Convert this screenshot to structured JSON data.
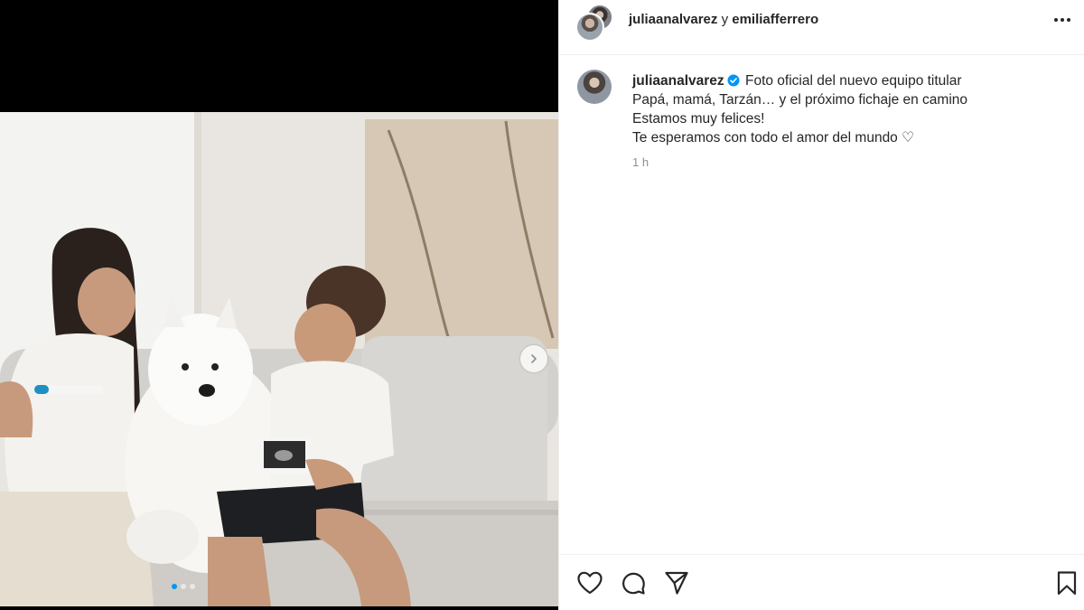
{
  "post": {
    "carousel": {
      "total_slides": 3,
      "current_slide": 1,
      "next_icon": "chevron-right-icon"
    }
  },
  "header": {
    "user1": "juliaanalvarez",
    "conjunction": "y",
    "user2": "emiliafferrero",
    "more_icon": "more-horizontal-icon"
  },
  "caption": {
    "username": "juliaanalvarez",
    "verified": true,
    "lines": [
      "Foto oficial del nuevo equipo titular",
      "Papá, mamá, Tarzán… y el próximo fichaje en camino",
      "Estamos muy felices!",
      "Te esperamos con todo el amor del mundo"
    ],
    "heart_emoji": "♡",
    "time": "1 h"
  },
  "actions": {
    "like_icon": "heart-icon",
    "comment_icon": "comment-icon",
    "share_icon": "share-icon",
    "save_icon": "bookmark-icon"
  },
  "colors": {
    "verified": "#0095f6",
    "text": "#262626",
    "muted": "#8e8e8e",
    "divider": "#efefef"
  }
}
